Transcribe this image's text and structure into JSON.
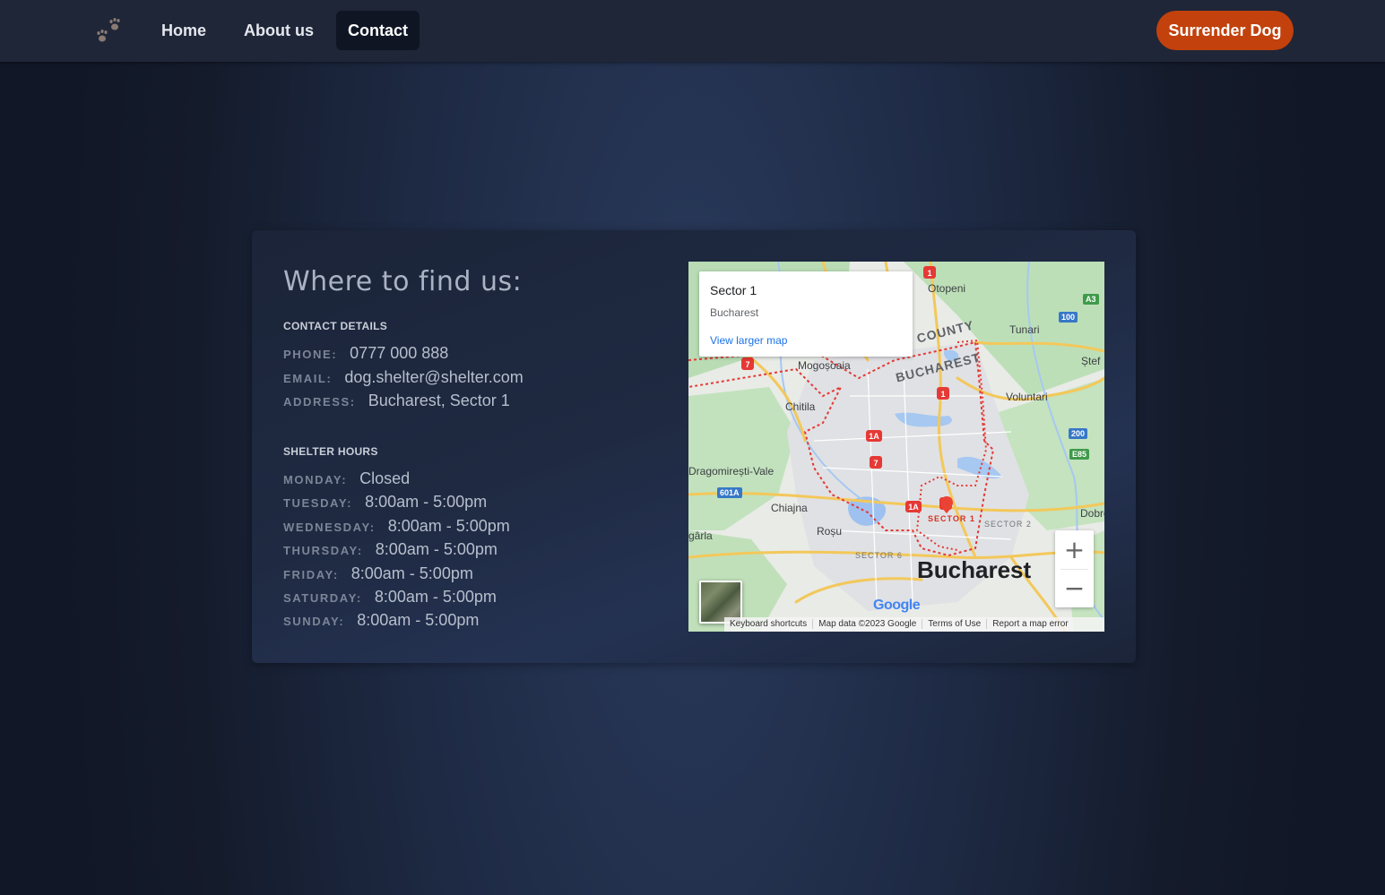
{
  "nav": {
    "items": [
      {
        "label": "Home"
      },
      {
        "label": "About us"
      },
      {
        "label": "Contact"
      }
    ],
    "cta_label": "Surrender Dog",
    "accent_color": "#c2410c"
  },
  "contact": {
    "heading": "Where to find us:",
    "details_title": "CONTACT DETAILS",
    "details": [
      {
        "label": "PHONE:",
        "value": "0777 000 888"
      },
      {
        "label": "EMAIL:",
        "value": "dog.shelter@shelter.com"
      },
      {
        "label": "ADDRESS:",
        "value": "Bucharest, Sector 1"
      }
    ],
    "hours_title": "SHELTER HOURS",
    "hours": [
      {
        "label": "MONDAY:",
        "value": "Closed"
      },
      {
        "label": "TUESDAY:",
        "value": "8:00am - 5:00pm"
      },
      {
        "label": "WEDNESDAY:",
        "value": "8:00am - 5:00pm"
      },
      {
        "label": "THURSDAY:",
        "value": "8:00am - 5:00pm"
      },
      {
        "label": "FRIDAY:",
        "value": "8:00am - 5:00pm"
      },
      {
        "label": "SATURDAY:",
        "value": "8:00am - 5:00pm"
      },
      {
        "label": "SUNDAY:",
        "value": "8:00am - 5:00pm"
      }
    ]
  },
  "map": {
    "info_title": "Sector 1",
    "info_subtitle": "Bucharest",
    "info_link": "View larger map",
    "zoom_in": "+",
    "zoom_out": "−",
    "footer": [
      "Keyboard shortcuts",
      "Map data ©2023 Google",
      "Terms of Use",
      "Report a map error"
    ],
    "logo_text": "Google",
    "labels": {
      "otopeni": "Otopeni",
      "tunari": "Tunari",
      "county": "COUNTY",
      "bucharest_region": "BUCHAREST",
      "mogosoaia": "Mogoșoaia",
      "voluntari": "Voluntari",
      "chitila": "Chitila",
      "dragomiresti": "Dragomirești-Vale",
      "chiajna": "Chiajna",
      "rosu": "Roșu",
      "sector1": "SECTOR 1",
      "sector2": "SECTOR 2",
      "sector6": "SECTOR 6",
      "bucharest_city": "Bucharest",
      "dobroe": "Dobroe",
      "stef": "Ștef",
      "garla": "gârla",
      "route_601a": "601A",
      "route_100": "100",
      "route_200": "200",
      "route_a3": "A3",
      "route_e85": "E85"
    }
  }
}
